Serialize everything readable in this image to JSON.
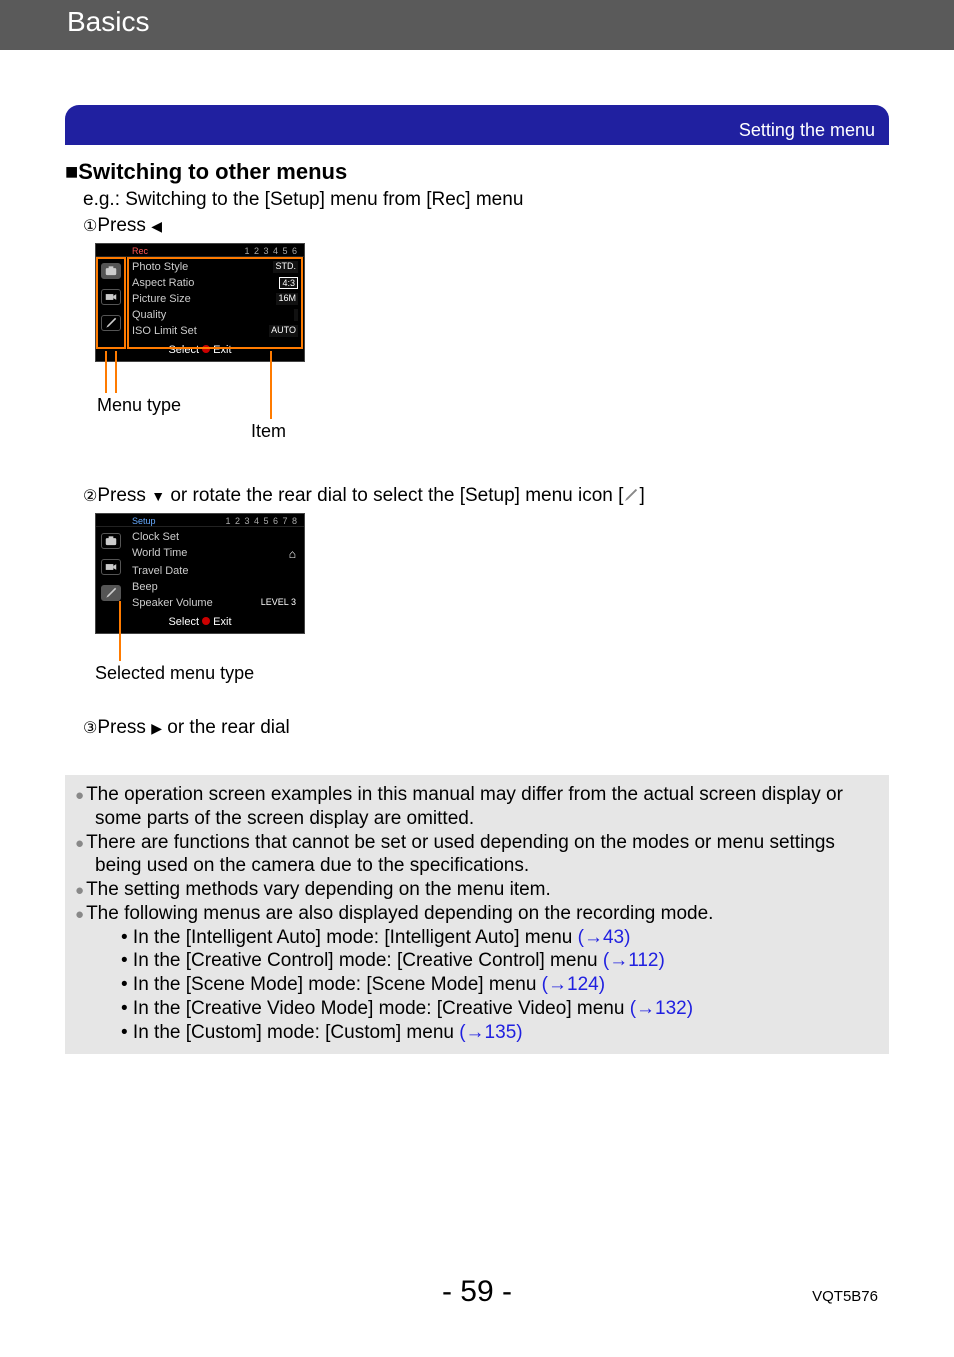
{
  "header": {
    "title": "Basics"
  },
  "blue_bar": {
    "label": "Setting the menu"
  },
  "section": {
    "marker": "■",
    "title": "Switching to other menus",
    "example": "e.g.: Switching to the [Setup] menu from [Rec] menu"
  },
  "steps": {
    "s1": {
      "num": "①",
      "text": "Press ",
      "after": ""
    },
    "s2": {
      "num": "②",
      "text_a": "Press ",
      "text_b": " or rotate the rear dial to select the [Setup] menu icon [",
      "text_c": "]"
    },
    "s3": {
      "num": "③",
      "text_a": "Press ",
      "text_b": " or the rear dial"
    }
  },
  "callouts": {
    "menu_type": "Menu type",
    "item": "Item",
    "selected": "Selected menu type"
  },
  "screenshot1": {
    "tab_label": "Rec",
    "pages": "1 2 3 4 5 6",
    "rows": [
      {
        "label": "Photo Style",
        "val": "STD."
      },
      {
        "label": "Aspect Ratio",
        "val": "4:3"
      },
      {
        "label": "Picture Size",
        "val": "16M"
      },
      {
        "label": "Quality",
        "val": ""
      },
      {
        "label": "ISO Limit Set",
        "val": "AUTO"
      }
    ],
    "footer_a": "Select ",
    "footer_b": " Exit"
  },
  "screenshot2": {
    "tab_label": "Setup",
    "pages": "1 2 3 4 5 6 7 8",
    "rows": [
      {
        "label": "Clock Set",
        "val": ""
      },
      {
        "label": "World Time",
        "val": "⌂"
      },
      {
        "label": "Travel Date",
        "val": ""
      },
      {
        "label": "Beep",
        "val": ""
      },
      {
        "label": "Speaker Volume",
        "val": "LEVEL 3"
      }
    ],
    "footer_a": "Select ",
    "footer_b": " Exit"
  },
  "notes": {
    "n1": "The operation screen examples in this manual may differ from the actual screen display or some parts of the screen display are omitted.",
    "n2": "There are functions that cannot be set or used depending on the modes or menu settings being used on the camera due to the specifications.",
    "n3": "The setting methods vary depending on the menu item.",
    "n4": "The following menus are also displayed depending on the recording mode.",
    "sub": [
      {
        "t": " • In the [Intelligent Auto] mode: [Intelligent Auto] menu ",
        "l": "(→43)"
      },
      {
        "t": " • In the [Creative Control] mode: [Creative Control] menu ",
        "l": "(→112)"
      },
      {
        "t": " • In the [Scene Mode] mode: [Scene Mode] menu ",
        "l": "(→124)"
      },
      {
        "t": " • In the [Creative Video Mode] mode: [Creative Video] menu ",
        "l": "(→132)"
      },
      {
        "t": " • In the [Custom] mode: [Custom] menu ",
        "l": "(→135)"
      }
    ]
  },
  "footer": {
    "page": "- 59 -",
    "doc_id": "VQT5B76"
  }
}
